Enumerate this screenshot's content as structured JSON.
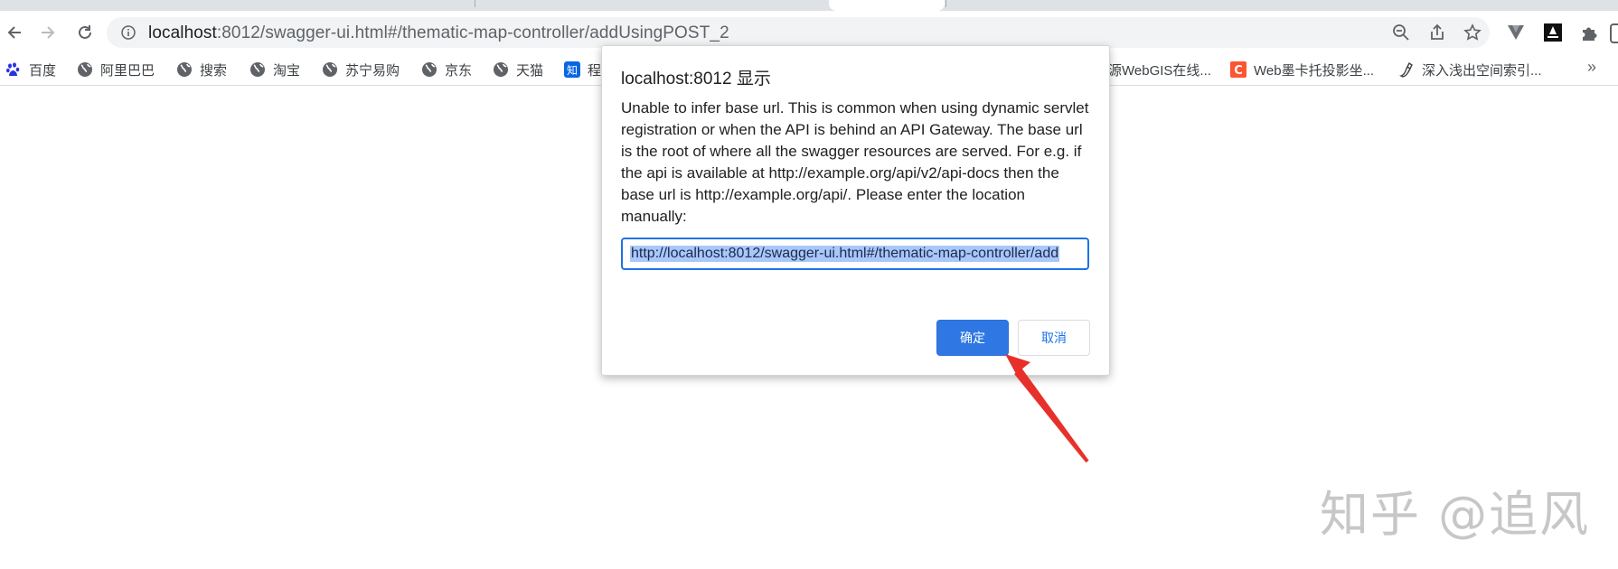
{
  "browser": {
    "url_host": "localhost",
    "url_rest": ":8012/swagger-ui.html#/thematic-map-controller/addUsingPOST_2"
  },
  "bookmarks": [
    {
      "label": "百度",
      "icon": "baidu-paw-icon"
    },
    {
      "label": "阿里巴巴",
      "icon": "globe-icon"
    },
    {
      "label": "搜索",
      "icon": "globe-icon"
    },
    {
      "label": "淘宝",
      "icon": "globe-icon"
    },
    {
      "label": "苏宁易购",
      "icon": "globe-icon"
    },
    {
      "label": "京东",
      "icon": "globe-icon"
    },
    {
      "label": "天猫",
      "icon": "globe-icon"
    },
    {
      "label": "程",
      "icon": "zhihu-icon"
    },
    {
      "label": "源WebGIS在线...",
      "icon": "none"
    },
    {
      "label": "Web墨卡托投影坐...",
      "icon": "c-logo-icon"
    },
    {
      "label": "深入浅出空间索引...",
      "icon": "pen-nib-icon"
    }
  ],
  "dialog": {
    "title": "localhost:8012 显示",
    "message": "Unable to infer base url. This is common when using dynamic servlet registration or when the API is behind an API Gateway. The base url is the root of where all the swagger resources are served. For e.g. if the api is available at http://example.org/api/v2/api-docs then the base url is http://example.org/api/. Please enter the location manually:",
    "input_value": "http://localhost:8012/swagger-ui.html#/thematic-map-controller/add",
    "ok_label": "确定",
    "cancel_label": "取消"
  },
  "watermark": "知乎 @追风",
  "colors": {
    "accent": "#1a73e8",
    "ok_button": "#2f78e3",
    "annotation_arrow": "#e8302a"
  }
}
